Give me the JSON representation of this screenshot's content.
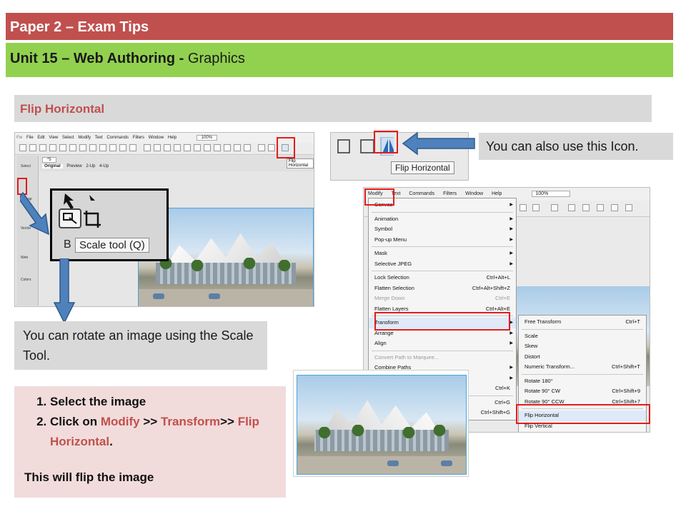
{
  "header": {
    "title": "Paper 2 – Exam Tips",
    "subtitle_bold": "Unit 15 – Web Authoring -",
    "subtitle_rest": " Graphics"
  },
  "section": {
    "title": "Flip Horizontal"
  },
  "notes": {
    "icon_note": "You can also use this Icon.",
    "scale_note": "You can rotate an image using the Scale Tool."
  },
  "steps": {
    "items": [
      {
        "plain": "Select the image"
      },
      {
        "prefix": "Click on ",
        "hl1": "Modify",
        "mid1": " >> ",
        "hl2": "Transform",
        "mid2": ">> ",
        "hl3": "Flip Horizontal",
        "suffix": "."
      }
    ],
    "conclusion": "This will flip the image"
  },
  "app_screenshot": {
    "app_logo": "Fw",
    "menus": [
      "File",
      "Edit",
      "View",
      "Select",
      "Modify",
      "Text",
      "Commands",
      "Filters",
      "Window",
      "Help"
    ],
    "zoom": "100%",
    "doc_tabs": [
      "Original",
      "Preview",
      "2-Up",
      "4-Up"
    ],
    "doc_name": "*5",
    "panel_labels": [
      "Select",
      "Bitmap",
      "Vector",
      "Web",
      "Colors"
    ],
    "flip_tooltip": "Flip Horizontal",
    "zoom_tool_tooltip": "Scale tool (Q)"
  },
  "icon_screenshot": {
    "tooltip": "Flip Horizontal"
  },
  "menu_screenshot": {
    "menubar": [
      "Modify",
      "Text",
      "Commands",
      "Filters",
      "Window",
      "Help"
    ],
    "zoom": "100%",
    "modify_items": [
      {
        "label": "Canvas",
        "arrow": true
      },
      {
        "label": "Animation",
        "arrow": true
      },
      {
        "label": "Symbol",
        "arrow": true
      },
      {
        "label": "Pop-up Menu",
        "arrow": true
      },
      {
        "label": "Mask",
        "arrow": true
      },
      {
        "label": "Selective JPEG",
        "arrow": true
      },
      {
        "label": "Lock Selection",
        "shortcut": "Ctrl+Alt+L"
      },
      {
        "label": "Flatten Selection",
        "shortcut": "Ctrl+Alt+Shift+Z"
      },
      {
        "label": "Merge Down",
        "shortcut": "Ctrl+E",
        "disabled": true
      },
      {
        "label": "Flatten Layers",
        "shortcut": "Ctrl+Alt+E"
      },
      {
        "label": "Transform",
        "arrow": true
      },
      {
        "label": "Arrange",
        "arrow": true
      },
      {
        "label": "Align",
        "arrow": true
      },
      {
        "label": "Convert Path to Marquee...",
        "disabled": true
      },
      {
        "label": "Combine Paths",
        "arrow": true
      },
      {
        "label": "",
        "arrow": true
      },
      {
        "label": "",
        "shortcut": "Ctrl+K"
      },
      {
        "label": "",
        "shortcut": "Ctrl+G"
      },
      {
        "label": "",
        "shortcut": "Ctrl+Shift+G"
      }
    ],
    "transform_items": [
      {
        "label": "Free Transform",
        "shortcut": "Ctrl+T"
      },
      {
        "label": "Scale"
      },
      {
        "label": "Skew"
      },
      {
        "label": "Distort"
      },
      {
        "label": "Numeric Transform...",
        "shortcut": "Ctrl+Shift+T"
      },
      {
        "label": "Rotate 180°"
      },
      {
        "label": "Rotate 90° CW",
        "shortcut": "Ctrl+Shift+9"
      },
      {
        "label": "Rotate 90° CCW",
        "shortcut": "Ctrl+Shift+7"
      },
      {
        "label": "Flip Horizontal"
      },
      {
        "label": "Flip Vertical"
      }
    ]
  },
  "colors": {
    "title_bar": "#c0504d",
    "subtitle_bar": "#92d050",
    "highlight": "#c0504d",
    "callout_border": "#e21b1b",
    "arrow": "#4f81bd"
  }
}
